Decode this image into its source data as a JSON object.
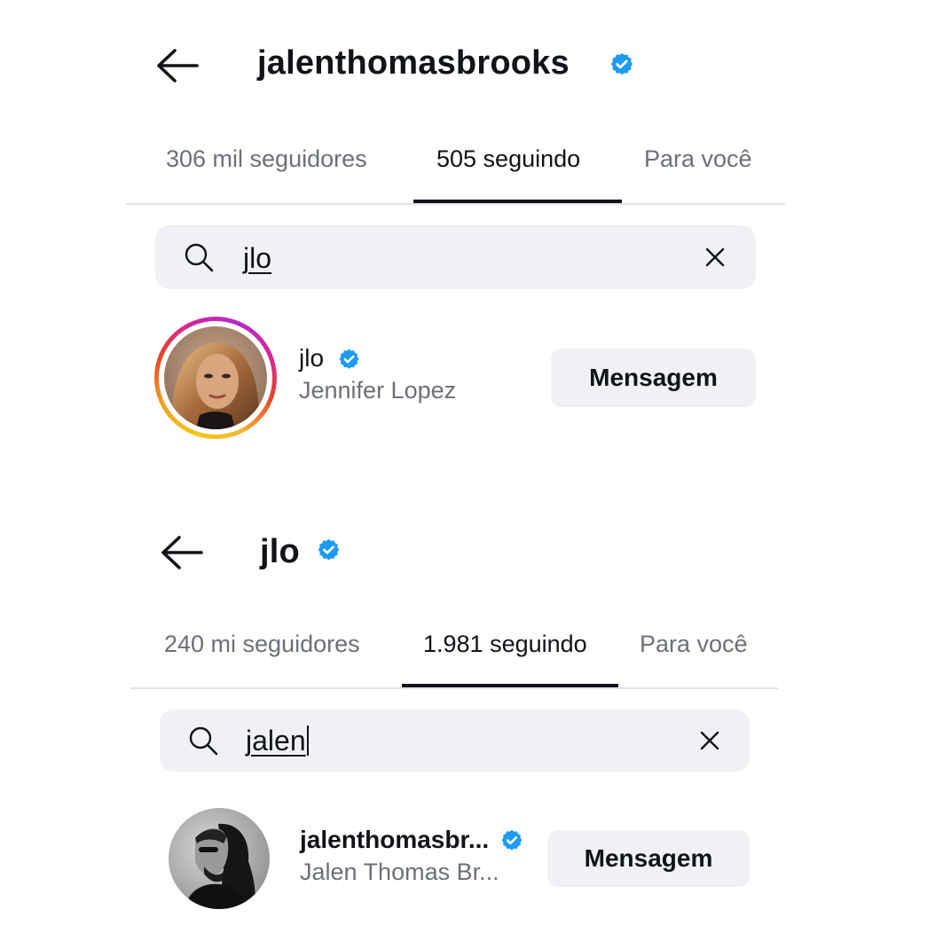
{
  "colors": {
    "verified_blue": "#1d9bf0",
    "text_primary": "#101318",
    "text_secondary": "#6b7078",
    "field_bg": "#eff1f4"
  },
  "panel1": {
    "header": {
      "back_icon": "arrow-left-icon",
      "title": "jalenthomasbrooks",
      "verified_icon": "verified-badge-icon"
    },
    "tabs": [
      {
        "label": "306 mil seguidores",
        "active": false
      },
      {
        "label": "505 seguindo",
        "active": true
      },
      {
        "label": "Para você",
        "active": false
      }
    ],
    "search": {
      "value": "jlo",
      "search_icon": "search-icon",
      "clear_icon": "close-icon"
    },
    "result": {
      "username": "jlo",
      "full_name": "Jennifer Lopez",
      "button_label": "Mensagem",
      "has_story_ring": true
    }
  },
  "panel2": {
    "header": {
      "back_icon": "arrow-left-icon",
      "title": "jlo",
      "verified_icon": "verified-badge-icon"
    },
    "tabs": [
      {
        "label": "240 mi seguidores",
        "active": false
      },
      {
        "label": "1.981 seguindo",
        "active": true
      },
      {
        "label": "Para você",
        "active": false
      }
    ],
    "search": {
      "value": "jalen",
      "search_icon": "search-icon",
      "clear_icon": "close-icon"
    },
    "result": {
      "username": "jalenthomasbr...",
      "full_name": "Jalen Thomas Br...",
      "button_label": "Mensagem",
      "has_story_ring": false
    }
  }
}
